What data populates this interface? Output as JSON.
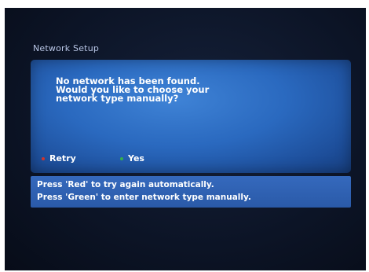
{
  "dialog": {
    "title": "Network Setup",
    "message": "No network has been found.\nWould you like to choose your\nnetwork type manually?",
    "options": [
      {
        "label": "Retry",
        "color": "#d0342c"
      },
      {
        "label": "Yes",
        "color": "#35b04a"
      }
    ]
  },
  "help": {
    "line1": "Press 'Red' to try again automatically.",
    "line2": "Press 'Green' to enter network type manually."
  }
}
